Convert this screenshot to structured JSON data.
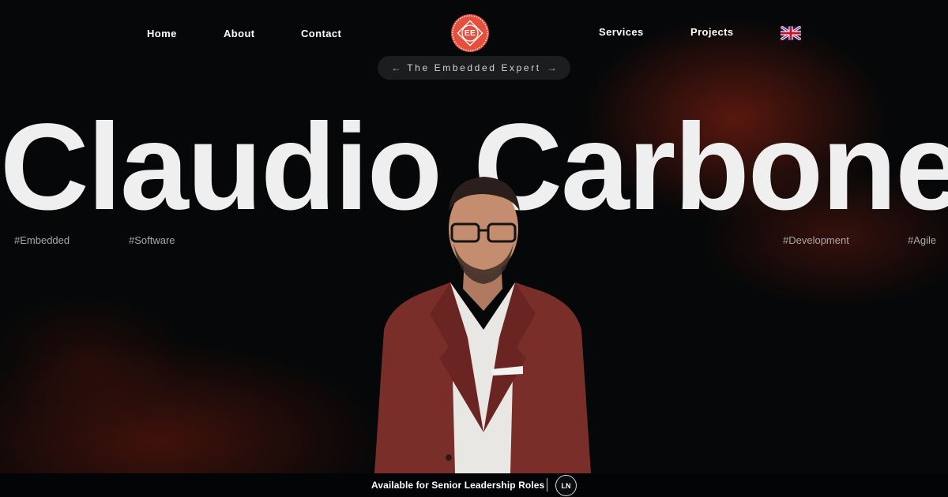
{
  "nav": {
    "left": [
      "Home",
      "About",
      "Contact"
    ],
    "right": [
      "Services",
      "Projects"
    ],
    "logo_text": "EE",
    "language_flag": "uk-flag-icon"
  },
  "tagline": {
    "text": "The Embedded Expert",
    "left_arrow": "←",
    "right_arrow": "→"
  },
  "hero": {
    "name": "Claudio Carbone",
    "tags": [
      "#Embedded",
      "#Software",
      "#Development",
      "#Agile"
    ]
  },
  "footer": {
    "availability": "Available for Senior Leadership Roles",
    "social_button": "LN"
  },
  "colors": {
    "accent": "#e5503e",
    "background": "#050708",
    "glow": "#6e1c10",
    "suit": "#7a2e2a"
  }
}
